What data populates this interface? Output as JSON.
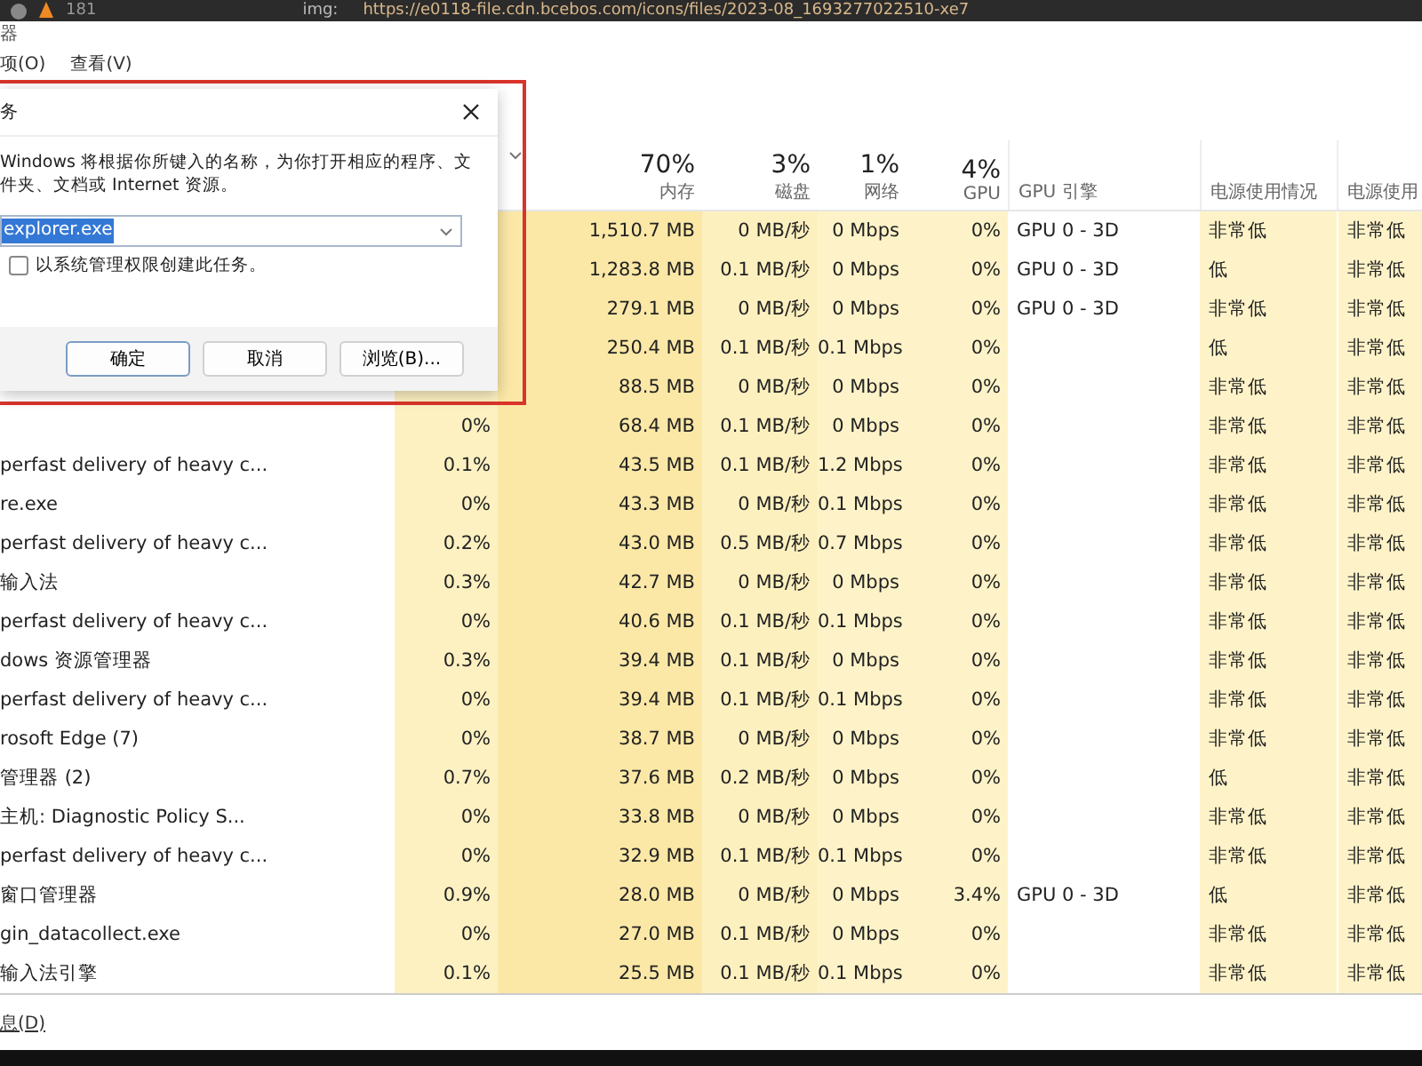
{
  "top_strip": {
    "count": "181",
    "label": "img:",
    "url": "https://e0118-file.cdn.bcebos.com/icons/files/2023-08_1693277022510-xe7"
  },
  "window": {
    "title": "器"
  },
  "menu": [
    "项(O)",
    "查看(V)"
  ],
  "columns": [
    {
      "percent": "70%",
      "label": "内存"
    },
    {
      "percent": "3%",
      "label": "磁盘"
    },
    {
      "percent": "1%",
      "label": "网络"
    },
    {
      "percent": "4%",
      "label": "GPU"
    },
    {
      "label": "GPU 引擎"
    },
    {
      "label": "电源使用情况"
    },
    {
      "label": "电源使用"
    }
  ],
  "rows": [
    {
      "memory": "1,510.7 MB",
      "disk": "0 MB/秒",
      "network": "0 Mbps",
      "gpu": "0%",
      "gpu_engine": "GPU 0 - 3D",
      "power": "非常低",
      "power_trend": "非常低"
    },
    {
      "memory": "1,283.8 MB",
      "disk": "0.1 MB/秒",
      "network": "0 Mbps",
      "gpu": "0%",
      "gpu_engine": "GPU 0 - 3D",
      "power": "低",
      "power_trend": "非常低"
    },
    {
      "memory": "279.1 MB",
      "disk": "0 MB/秒",
      "network": "0 Mbps",
      "gpu": "0%",
      "gpu_engine": "GPU 0 - 3D",
      "power": "非常低",
      "power_trend": "非常低"
    },
    {
      "memory": "250.4 MB",
      "disk": "0.1 MB/秒",
      "network": "0.1 Mbps",
      "gpu": "0%",
      "power": "低",
      "power_trend": "非常低"
    },
    {
      "memory": "88.5 MB",
      "disk": "0 MB/秒",
      "network": "0 Mbps",
      "gpu": "0%",
      "power": "非常低",
      "power_trend": "非常低"
    },
    {
      "cpu": "0%",
      "memory": "68.4 MB",
      "disk": "0.1 MB/秒",
      "network": "0 Mbps",
      "gpu": "0%",
      "power": "非常低",
      "power_trend": "非常低"
    },
    {
      "name": "perfast delivery of heavy c...",
      "cpu": "0.1%",
      "memory": "43.5 MB",
      "disk": "0.1 MB/秒",
      "network": "1.2 Mbps",
      "gpu": "0%",
      "power": "非常低",
      "power_trend": "非常低"
    },
    {
      "name": "re.exe",
      "cpu": "0%",
      "memory": "43.3 MB",
      "disk": "0 MB/秒",
      "network": "0.1 Mbps",
      "gpu": "0%",
      "power": "非常低",
      "power_trend": "非常低"
    },
    {
      "name": "perfast delivery of heavy c...",
      "cpu": "0.2%",
      "memory": "43.0 MB",
      "disk": "0.5 MB/秒",
      "network": "0.7 Mbps",
      "gpu": "0%",
      "power": "非常低",
      "power_trend": "非常低"
    },
    {
      "name": "输入法",
      "cpu": "0.3%",
      "memory": "42.7 MB",
      "disk": "0 MB/秒",
      "network": "0 Mbps",
      "gpu": "0%",
      "power": "非常低",
      "power_trend": "非常低"
    },
    {
      "name": "perfast delivery of heavy c...",
      "cpu": "0%",
      "memory": "40.6 MB",
      "disk": "0.1 MB/秒",
      "network": "0.1 Mbps",
      "gpu": "0%",
      "power": "非常低",
      "power_trend": "非常低"
    },
    {
      "name": "dows 资源管理器",
      "cpu": "0.3%",
      "memory": "39.4 MB",
      "disk": "0.1 MB/秒",
      "network": "0 Mbps",
      "gpu": "0%",
      "power": "非常低",
      "power_trend": "非常低"
    },
    {
      "name": "perfast delivery of heavy c...",
      "cpu": "0%",
      "memory": "39.4 MB",
      "disk": "0.1 MB/秒",
      "network": "0.1 Mbps",
      "gpu": "0%",
      "power": "非常低",
      "power_trend": "非常低"
    },
    {
      "name": "rosoft Edge (7)",
      "cpu": "0%",
      "memory": "38.7 MB",
      "disk": "0 MB/秒",
      "network": "0 Mbps",
      "gpu": "0%",
      "power": "非常低",
      "power_trend": "非常低"
    },
    {
      "name": "管理器 (2)",
      "cpu": "0.7%",
      "memory": "37.6 MB",
      "disk": "0.2 MB/秒",
      "network": "0 Mbps",
      "gpu": "0%",
      "power": "低",
      "power_trend": "非常低"
    },
    {
      "name": "主机: Diagnostic Policy S...",
      "cpu": "0%",
      "memory": "33.8 MB",
      "disk": "0 MB/秒",
      "network": "0 Mbps",
      "gpu": "0%",
      "power": "非常低",
      "power_trend": "非常低"
    },
    {
      "name": "perfast delivery of heavy c...",
      "cpu": "0%",
      "memory": "32.9 MB",
      "disk": "0.1 MB/秒",
      "network": "0.1 Mbps",
      "gpu": "0%",
      "power": "非常低",
      "power_trend": "非常低"
    },
    {
      "name": "窗口管理器",
      "cpu": "0.9%",
      "memory": "28.0 MB",
      "disk": "0 MB/秒",
      "network": "0 Mbps",
      "gpu": "3.4%",
      "gpu_engine": "GPU 0 - 3D",
      "power": "低",
      "power_trend": "非常低"
    },
    {
      "name": "gin_datacollect.exe",
      "cpu": "0%",
      "memory": "27.0 MB",
      "disk": "0.1 MB/秒",
      "network": "0 Mbps",
      "gpu": "0%",
      "power": "非常低",
      "power_trend": "非常低"
    },
    {
      "name": "输入法引擎",
      "cpu": "0.1%",
      "memory": "25.5 MB",
      "disk": "0.1 MB/秒",
      "network": "0.1 Mbps",
      "gpu": "0%",
      "power": "非常低",
      "power_trend": "非常低"
    }
  ],
  "footer": {
    "link": "息(D)"
  },
  "dialog": {
    "title": "务",
    "description_lines": [
      "Windows 将根据你所键入的名称，为你打开相应的程序、文",
      "件夹、文档或 Internet 资源。"
    ],
    "open_value": "explorer.exe",
    "admin_checkbox": {
      "label": "以系统管理权限创建此任务。",
      "checked": false
    },
    "buttons": [
      "确定",
      "取消",
      "浏览(B)..."
    ]
  }
}
